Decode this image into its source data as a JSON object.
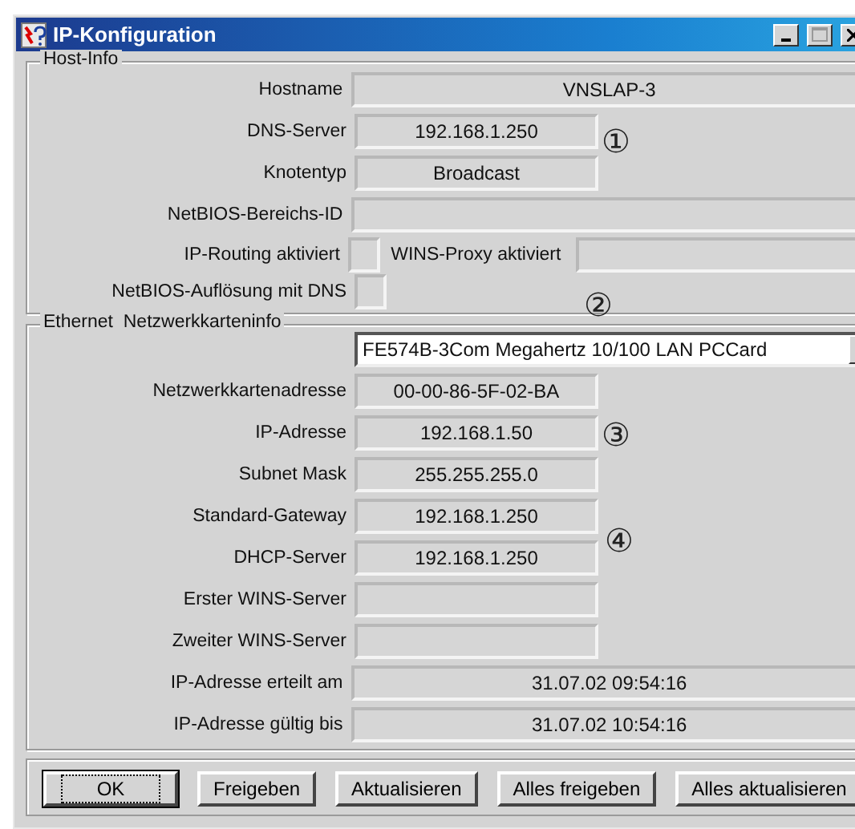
{
  "window": {
    "title": "IP-Konfiguration"
  },
  "host_info": {
    "title": "Host-Info",
    "rows": [
      {
        "kind": "wide",
        "label": "Hostname",
        "value": "VNSLAP-3"
      },
      {
        "kind": "short",
        "label": "DNS-Server",
        "value": "192.168.1.250"
      },
      {
        "kind": "short",
        "label": "Knotentyp",
        "value": "Broadcast"
      },
      {
        "kind": "wide",
        "label": "NetBIOS-Bereichs-ID"
      },
      {
        "kind": "pair",
        "label": "IP-Routing aktiviert",
        "second_label": "WINS-Proxy aktiviert"
      },
      {
        "kind": "tiny",
        "label": "NetBIOS-Auflösung mit DNS"
      }
    ]
  },
  "ethernet": {
    "title": "Ethernet  Netzwerkkarteninfo",
    "adapter": "FE574B-3Com Megahertz 10/100 LAN PCCard",
    "rows": [
      {
        "kind": "short",
        "label": "Netzwerkkartenadresse",
        "value": "00-00-86-5F-02-BA"
      },
      {
        "kind": "short",
        "label": "IP-Adresse",
        "value": "192.168.1.50"
      },
      {
        "kind": "short",
        "label": "Subnet Mask",
        "value": "255.255.255.0"
      },
      {
        "kind": "short",
        "label": "Standard-Gateway",
        "value": "192.168.1.250"
      },
      {
        "kind": "short",
        "label": "DHCP-Server",
        "value": "192.168.1.250"
      },
      {
        "kind": "short",
        "label": "Erster WINS-Server"
      },
      {
        "kind": "short",
        "label": "Zweiter WINS-Server"
      },
      {
        "kind": "wide",
        "label": "IP-Adresse erteilt am",
        "value": "31.07.02 09:54:16"
      },
      {
        "kind": "wide",
        "label": "IP-Adresse gültig bis",
        "value": "31.07.02 10:54:16"
      }
    ]
  },
  "buttons": [
    {
      "label": "OK",
      "default": true
    },
    {
      "label": "Freigeben",
      "default": false
    },
    {
      "label": "Aktualisieren",
      "default": false
    },
    {
      "label": "Alles freigeben",
      "default": false
    },
    {
      "label": "Alles aktualisieren",
      "default": false
    }
  ],
  "callouts": [
    "①",
    "②",
    "③",
    "④"
  ]
}
